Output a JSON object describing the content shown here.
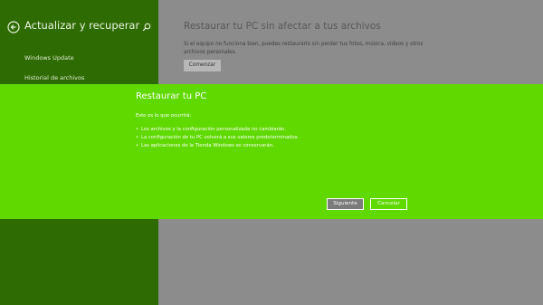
{
  "sidebar": {
    "title": "Actualizar y recuperar",
    "items": [
      {
        "label": "Windows Update"
      },
      {
        "label": "Historial de archivos"
      }
    ]
  },
  "main": {
    "title": "Restaurar tu PC sin afectar a tus archivos",
    "description": "Si el equipo no funciona bien, puedes restaurarlo sin perder tus fotos, música, videos y otros archivos personales.",
    "button_label": "Comenzar"
  },
  "dialog": {
    "title": "Restaurar tu PC",
    "intro": "Esto es lo que ocurrirá:",
    "bullets": [
      {
        "text": "Los archivos y la configuración personalizada no cambiarán."
      },
      {
        "text": "La configuración de tu PC volverá a sus valores predeterminados."
      },
      {
        "text": "Las aplicaciones de la Tienda Windows se conservarán."
      }
    ],
    "next_label": "Siguiente",
    "cancel_label": "Cancelar"
  },
  "colors": {
    "sidebar_bg": "#2e6b03",
    "main_bg": "#8c8c8c",
    "dialog_bg": "#5fd900"
  },
  "icons": {
    "back": "back-arrow-icon",
    "search": "search-icon"
  }
}
